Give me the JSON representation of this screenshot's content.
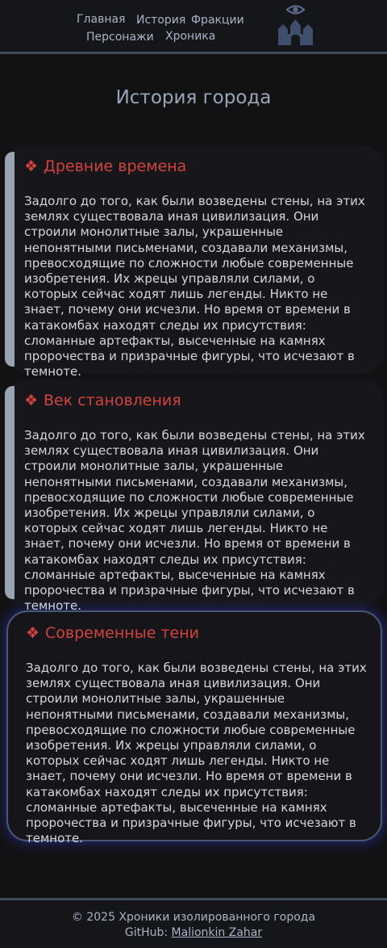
{
  "nav": {
    "home": "Главная",
    "history": "История",
    "factions": "Фракции",
    "characters": "Персонажи",
    "chronicle": "Хроника"
  },
  "logo_icon": "castle-eye-icon",
  "page_title": "История города",
  "cards": [
    {
      "title": "Древние времена",
      "text": "Задолго до того, как были возведены стены, на этих землях существовала иная цивилизация. Они строили монолитные залы, украшенные непонятными письменами, создавали механизмы, превосходящие по сложности любые современные изобретения. Их жрецы управляли силами, о которых сейчас ходят лишь легенды. Никто не знает, почему они исчезли. Но время от времени в катакомбах находят следы их присутствия: сломанные артефакты, высеченные на камнях пророчества и призрачные фигуры, что исчезают в темноте."
    },
    {
      "title": "Век становления",
      "text": "Задолго до того, как были возведены стены, на этих землях существовала иная цивилизация. Они строили монолитные залы, украшенные непонятными письменами, создавали механизмы, превосходящие по сложности любые современные изобретения. Их жрецы управляли силами, о которых сейчас ходят лишь легенды. Никто не знает, почему они исчезли. Но время от времени в катакомбах находят следы их присутствия: сломанные артефакты, высеченные на камнях пророчества и призрачные фигуры, что исчезают в темноте."
    },
    {
      "title": "Современные тени",
      "text": "Задолго до того, как были возведены стены, на этих землях существовала иная цивилизация. Они строили монолитные залы, украшенные непонятными письменами, создавали механизмы, превосходящие по сложности любые современные изобретения. Их жрецы управляли силами, о которых сейчас ходят лишь легенды. Никто не знает, почему они исчезли. Но время от времени в катакомбах находят следы их присутствия: сломанные артефакты, высеченные на камнях пророчества и призрачные фигуры, что исчезают в темноте."
    }
  ],
  "title_icon": "diamond-ornament-icon",
  "footer": {
    "copyright": "© 2025 Хроники изолированного города",
    "github_label": "GitHub:",
    "github_link": "Malionkin Zahar"
  },
  "colors": {
    "accent_red": "#d2423e",
    "nav_text": "#a9b4c6",
    "border": "#3d4a5c",
    "glow": "#3038be"
  }
}
